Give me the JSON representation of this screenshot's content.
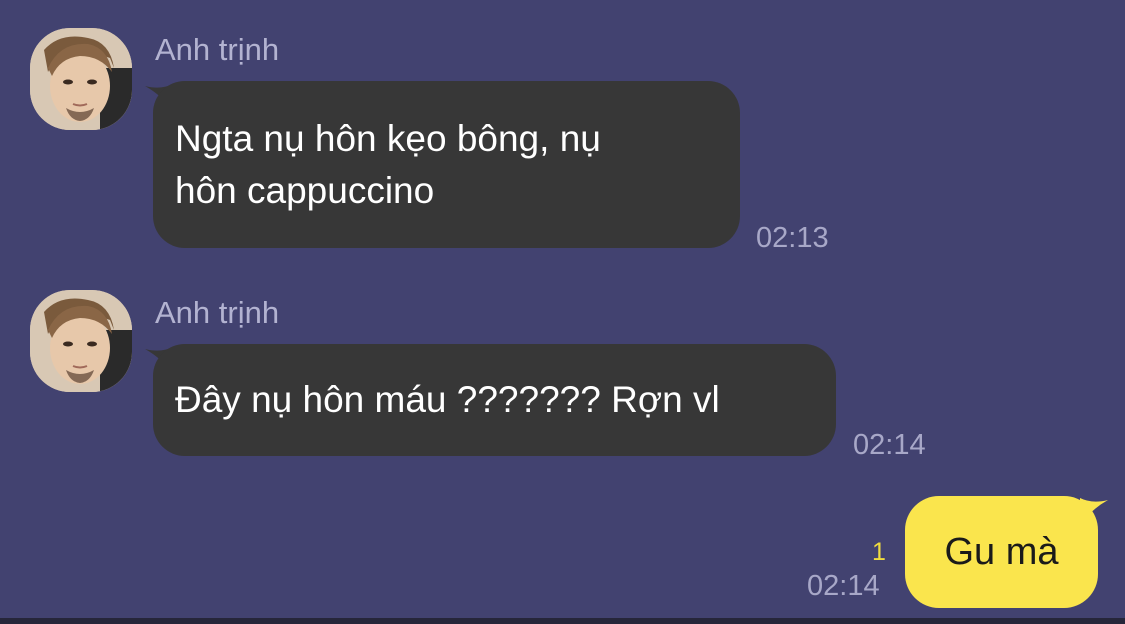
{
  "conversation": {
    "messages": [
      {
        "sender": "Anh trịnh",
        "avatar": "sender-avatar",
        "lines": [
          "Ngta nụ hôn kẹo bông, nụ",
          "hôn cappuccino"
        ],
        "time": "02:13"
      },
      {
        "sender": "Anh trịnh",
        "avatar": "sender-avatar",
        "lines": [
          "Đây nụ hôn máu ??????? Rợn vl"
        ],
        "time": "02:14"
      }
    ],
    "outgoing": {
      "text": "Gu mà",
      "time": "02:14",
      "unread_count": "1"
    }
  },
  "colors": {
    "background": "#424270",
    "incoming_bubble": "#373737",
    "outgoing_bubble": "#fae54d",
    "sender_name": "#b3b3d1",
    "timestamp": "#a8a8c8",
    "unread": "#f0dc3f"
  }
}
